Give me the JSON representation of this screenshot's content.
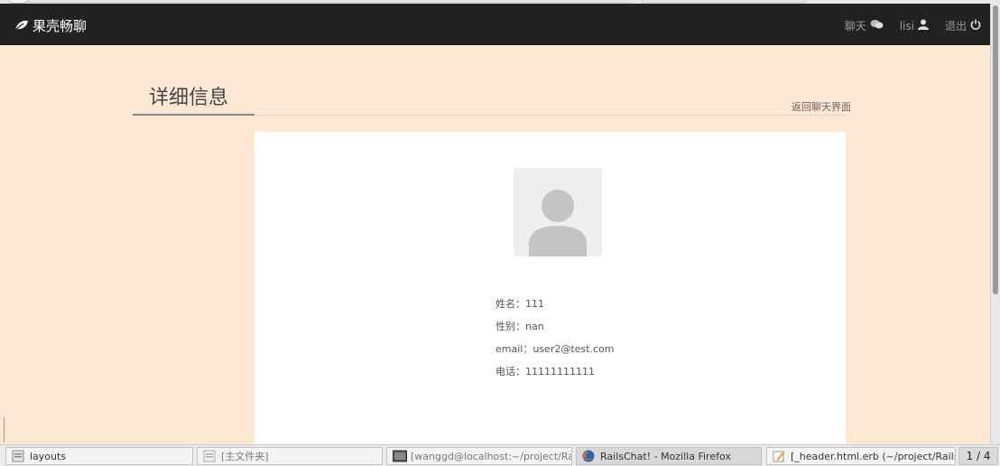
{
  "app": {
    "brand": "果壳畅聊"
  },
  "nav": {
    "chat_label": "聊天",
    "user_label": "lisi",
    "logout_label": "退出"
  },
  "page": {
    "title": "详细信息",
    "back_link": "返回聊天界面"
  },
  "profile": {
    "rows": [
      {
        "label": "姓名：",
        "value": "111"
      },
      {
        "label": "性别：",
        "value": "nan"
      },
      {
        "label": "email：",
        "value": "user2@test.com"
      },
      {
        "label": "电话：",
        "value": "11111111111"
      }
    ]
  },
  "taskbar": {
    "items": [
      {
        "label": "layouts",
        "icon": "file-manager-icon"
      },
      {
        "label": "[主文件夹]",
        "icon": "file-manager-icon"
      },
      {
        "label": "[wanggd@localhost:~/project/Rails…",
        "icon": "terminal-icon"
      },
      {
        "label": "RailsChat! - Mozilla Firefox",
        "icon": "firefox-icon"
      },
      {
        "label": "[_header.html.erb (~/project/RailsC…",
        "icon": "text-editor-icon"
      }
    ],
    "pager": "1 / 4"
  },
  "colors": {
    "page_bg": "#fde9d3",
    "navbar_bg": "#222222",
    "card_bg": "#ffffff"
  }
}
